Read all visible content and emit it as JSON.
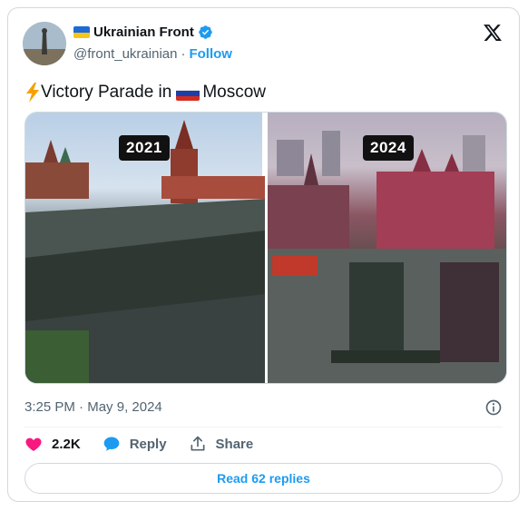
{
  "author": {
    "display_name": "Ukrainian Front",
    "handle": "@front_ukrainian",
    "follow_label": "Follow",
    "verified": true
  },
  "tweet": {
    "text_part1": "Victory Parade in ",
    "text_part2": "Moscow",
    "emoji_icon": "lightning-icon",
    "flag_icon": "russia-flag-icon"
  },
  "media": {
    "left_year": "2021",
    "right_year": "2024"
  },
  "meta": {
    "time": "3:25 PM",
    "separator": "·",
    "date": "May 9, 2024"
  },
  "actions": {
    "likes": "2.2K",
    "reply_label": "Reply",
    "share_label": "Share"
  },
  "read_replies_label": "Read 62 replies",
  "colors": {
    "accent": "#1d9bf0",
    "like": "#f91880",
    "muted": "#536471",
    "text": "#0f1419"
  }
}
